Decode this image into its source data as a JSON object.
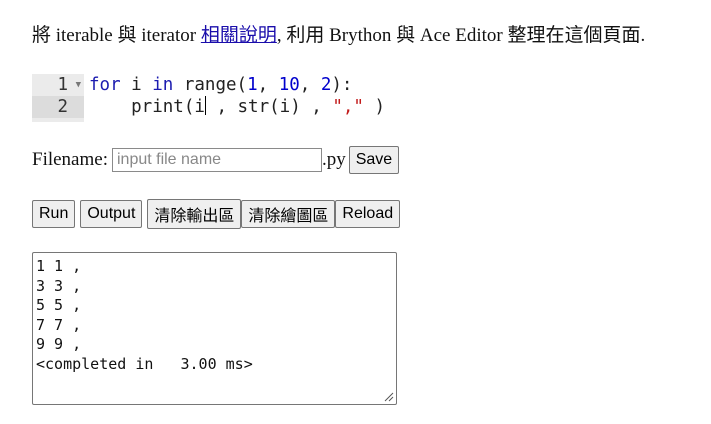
{
  "intro": {
    "text_before": "將 iterable 與 iterator ",
    "link_text": "相關說明",
    "text_after": ", 利用 Brython 與 Ace Editor 整理在這個頁面."
  },
  "editor": {
    "line_numbers": [
      "1",
      "2"
    ],
    "line1": {
      "kw_for": "for",
      "var": " i ",
      "kw_in": "in",
      "func": " range(",
      "n1": "1",
      "sep1": ", ",
      "n2": "10",
      "sep2": ", ",
      "n3": "2",
      "close": "):"
    },
    "line2": {
      "indent_func": "    print(i",
      "rest1": " , str(i) , ",
      "str": "\",\"",
      "rest2": " )"
    }
  },
  "filename": {
    "label": "Filename:",
    "placeholder": "input file name",
    "value": "",
    "ext": ".py",
    "save_label": "Save"
  },
  "buttons": {
    "run": "Run",
    "output": "Output",
    "clear_output": "清除輸出區",
    "clear_canvas": "清除繪圖區",
    "reload": "Reload"
  },
  "output": {
    "lines": [
      "1 1 ,",
      "3 3 ,",
      "5 5 ,",
      "7 7 ,",
      "9 9 ,",
      "<completed in   3.00 ms>"
    ]
  }
}
